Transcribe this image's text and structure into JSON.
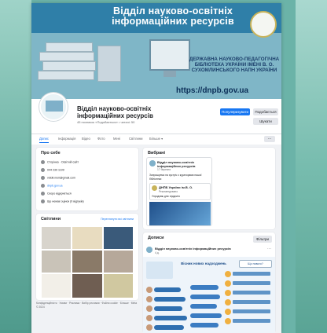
{
  "cover": {
    "title": "Відділ науково-освітніх інформаційних ресурсів",
    "library": "ДЕРЖАВНА НАУКОВО-ПЕДАГОГІЧНА БІБЛІОТЕКА УКРАЇНИ ІМЕНІ В. О. СУХОМЛИНСЬКОГО НАПН УКРАЇНИ",
    "url": "https://dnpb.gov.ua"
  },
  "profile": {
    "name": "Відділ науково-освітніх інформаційних ресурсів",
    "meta": "45 позначок «Подобається» • читачі: 50",
    "btn_promote": "Популяризувати",
    "btn_like": "Подобається",
    "btn_search": "Шукати"
  },
  "tabs": [
    "Допис",
    "Інформація",
    "Відео",
    "Фото",
    "Мені",
    "Світлини",
    "Більше ▾"
  ],
  "tab_more": "···",
  "about": {
    "title": "Про себе",
    "rows": [
      {
        "icon": "info-icon",
        "text": "Сторінка · Освітній сайт"
      },
      {
        "icon": "phone-icon",
        "text": "044 239 1199"
      },
      {
        "icon": "mail-icon",
        "text": "viddil.nioir@gmail.com"
      },
      {
        "icon": "link-icon",
        "text": "dnpb.gov.ua",
        "link": true
      },
      {
        "icon": "clock-icon",
        "text": "Скоро відкриється"
      },
      {
        "icon": "rating-icon",
        "text": "Ще немає оцінок (0 відгуків)"
      }
    ]
  },
  "photos": {
    "title": "Світлини",
    "link": "Переглянути всі світлини"
  },
  "footer": "Конфіденційність · Умови · Реклама · Вибір реклами · Файли cookie · Більше · Meta © 2024",
  "featured": {
    "title": "Вибрані",
    "post_name": "Відділ науково-освітніх інформаційних ресурсів",
    "post_date": "17 березня",
    "post_text": "Запрошуємо на зустріч з кураторами нашої бібліотеки",
    "inner_name": "ДНПБ України ім.В. О.",
    "inner_sub": "Рекомендовано",
    "inner_text": "Упродовж дня: відкрито"
  },
  "posts": {
    "title": "Дописи",
    "filter": "Фільтри",
    "post_name": "Відділ науково-освітніх інформаційних ресурсів",
    "post_date": "4 д.",
    "ig_title": "Вісник нових надходжень",
    "ig_side": "Що нового?"
  }
}
